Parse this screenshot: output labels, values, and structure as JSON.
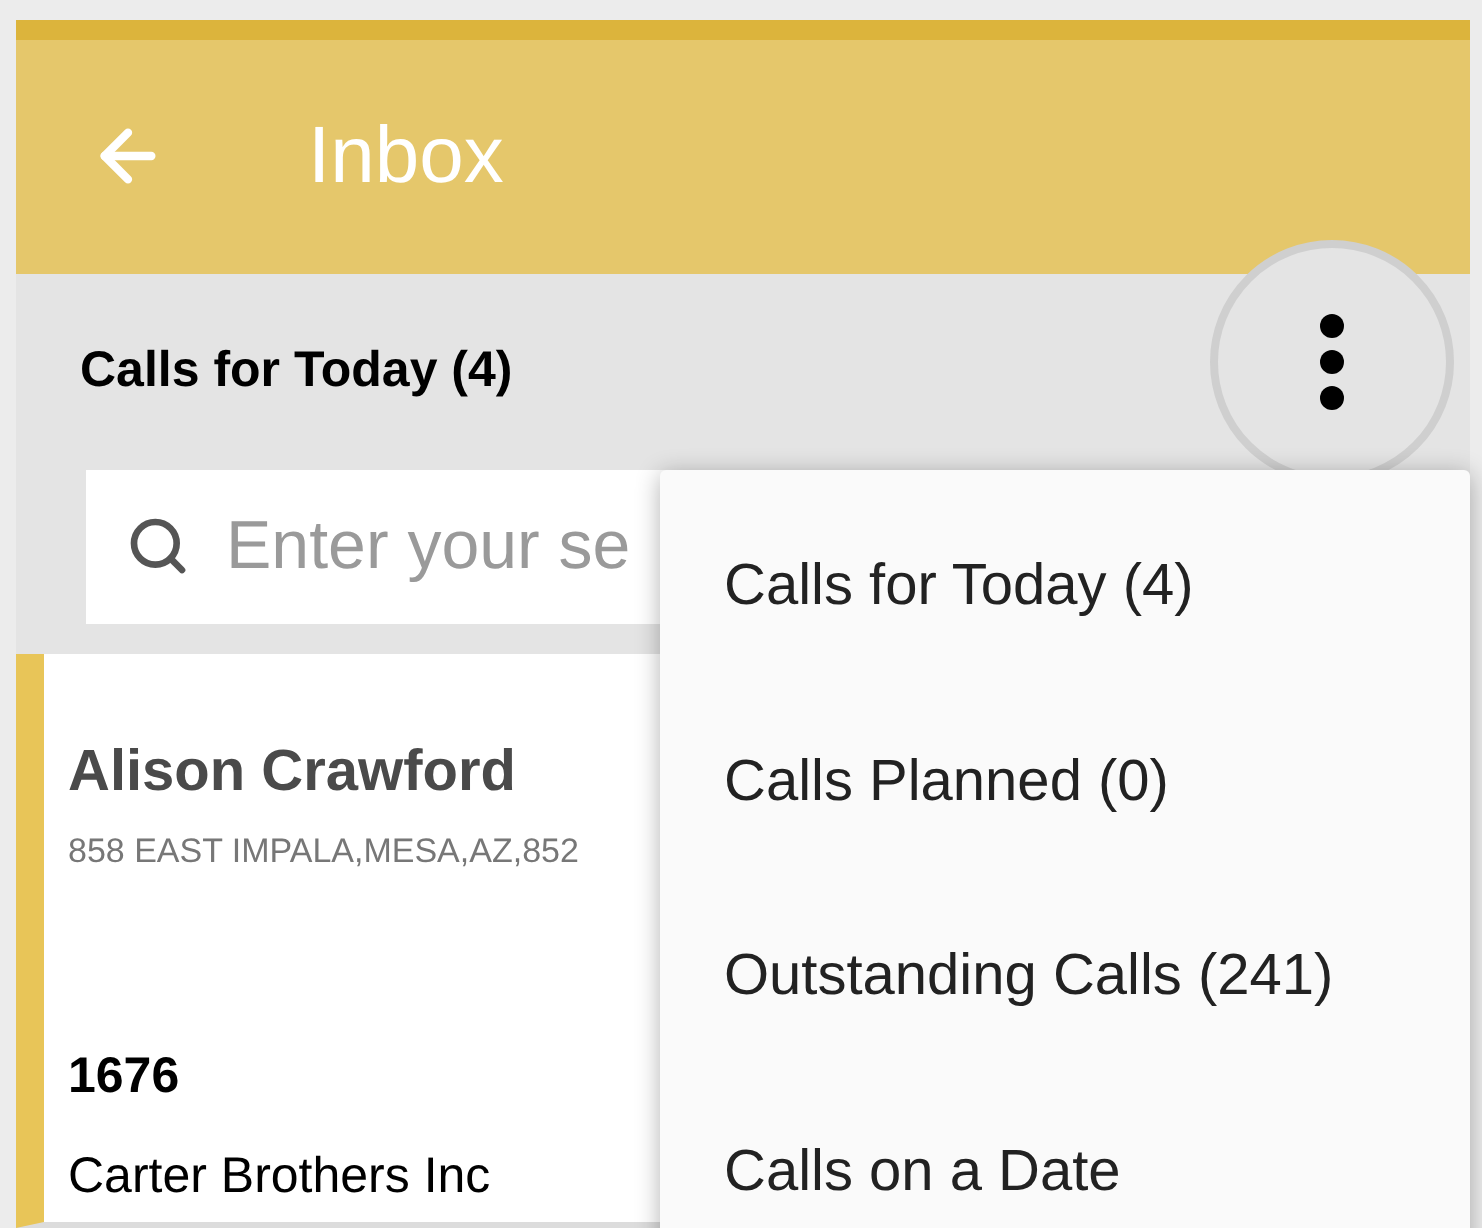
{
  "header": {
    "title": "Inbox"
  },
  "list_title": "Calls for Today (4)",
  "search": {
    "placeholder": "Enter your se"
  },
  "cards": [
    {
      "name": "Alison Crawford",
      "address": "858 EAST IMPALA,MESA,AZ,852",
      "number": "1676",
      "company": "Carter Brothers Inc"
    }
  ],
  "menu": {
    "items": [
      {
        "label": "Calls for Today (4)"
      },
      {
        "label": "Calls Planned (0)"
      },
      {
        "label": "Outstanding Calls (241)"
      },
      {
        "label": "Calls on a Date"
      }
    ]
  }
}
